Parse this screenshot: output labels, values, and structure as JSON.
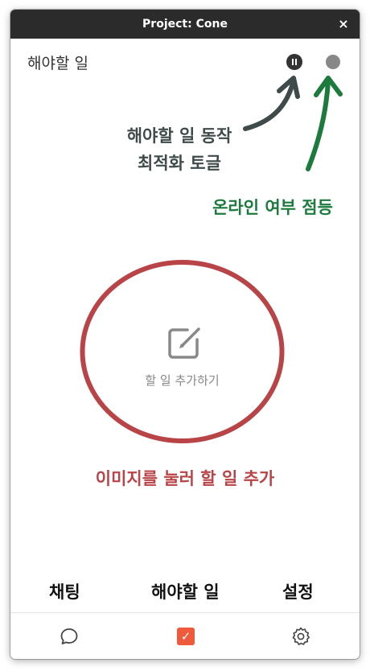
{
  "window": {
    "title": "Project: Cone",
    "close_glyph": "×"
  },
  "header": {
    "title": "해야할 일",
    "pause_icon": "pause-circle-icon",
    "status_color": "#888888"
  },
  "annotations": {
    "pause_toggle_line1": "해야할 일 동작",
    "pause_toggle_line2": "최적화 토글",
    "online_status": "온라인 여부 점등",
    "add_hint": "이미지를 눌러 할 일 추가",
    "colors": {
      "pause": "#3f4a4a",
      "online": "#1c7a3c",
      "add": "#b94447"
    }
  },
  "main": {
    "add_label": "할 일 추가하기",
    "add_icon": "edit-square-icon"
  },
  "bottom_nav": {
    "labels": [
      "채팅",
      "해야할 일",
      "설정"
    ],
    "icons": [
      "chat-bubble-icon",
      "todo-checkbox-icon",
      "gear-icon"
    ],
    "active_color": "#f05a3c"
  }
}
